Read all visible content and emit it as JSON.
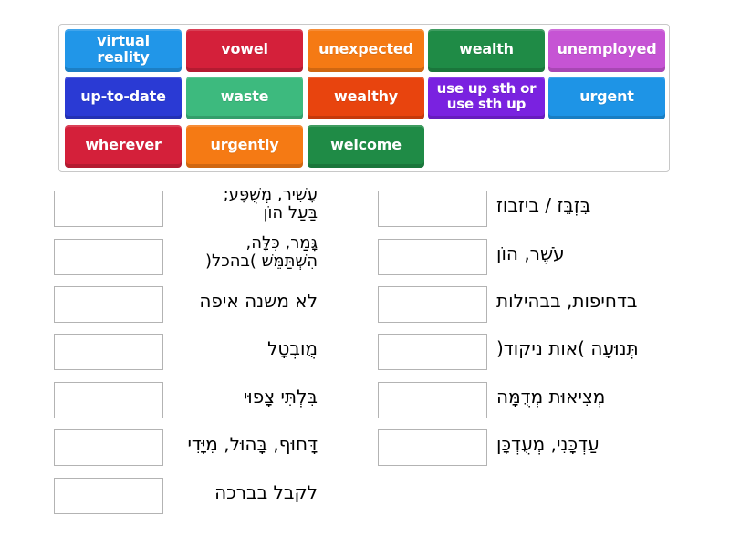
{
  "tile_bank": {
    "tiles": [
      {
        "label": "virtual reality",
        "color": "#2196e8"
      },
      {
        "label": "vowel",
        "color": "#d4203a"
      },
      {
        "label": "unexpected",
        "color": "#f57a14"
      },
      {
        "label": "wealth",
        "color": "#1f8b46"
      },
      {
        "label": "unemployed",
        "color": "#c654d4"
      },
      {
        "label": "up-to-date",
        "color": "#2a3ad4"
      },
      {
        "label": "waste",
        "color": "#3dba7e"
      },
      {
        "label": "wealthy",
        "color": "#e8440e"
      },
      {
        "label": "use up sth or use sth up",
        "line1": "use up sth or",
        "line2": "use sth up",
        "color": "#7a22e0"
      },
      {
        "label": "urgent",
        "color": "#1e94e6"
      },
      {
        "label": "wherever",
        "color": "#d4203a"
      },
      {
        "label": "urgently",
        "color": "#f57a14"
      },
      {
        "label": "welcome",
        "color": "#1f8b46"
      }
    ]
  },
  "clues": {
    "left": [
      {
        "line1": "עָשִׁיר, מְשֻׁפָּע;",
        "line2": "בַּעַל הוֹן"
      },
      {
        "line1": "גָּמַר, כִּלָּה,",
        "line2": "הִשְׁתַּמֵּשׁ )בהכל("
      },
      {
        "text": "לא משנה איפה"
      },
      {
        "text": "מֻובְטָל"
      },
      {
        "text": "בִּלְתִּי צָפוּי"
      },
      {
        "text": "דָּחוּף, בָּהוּל, מִיָּדִי"
      },
      {
        "text": "לקבל בברכה"
      }
    ],
    "right": [
      {
        "text": "בִּזְבֵּז / ביזבוז"
      },
      {
        "text": "עֹשֶׁר, הוֹן"
      },
      {
        "text": "בדחיפות, בבהילות"
      },
      {
        "text": "תְּנוּעָה )אות ניקוד("
      },
      {
        "text": "מְצִיאוּת מְדֻמָּה"
      },
      {
        "text": "עַדְכָּנִי, מְעֻדְכָּן"
      }
    ]
  }
}
